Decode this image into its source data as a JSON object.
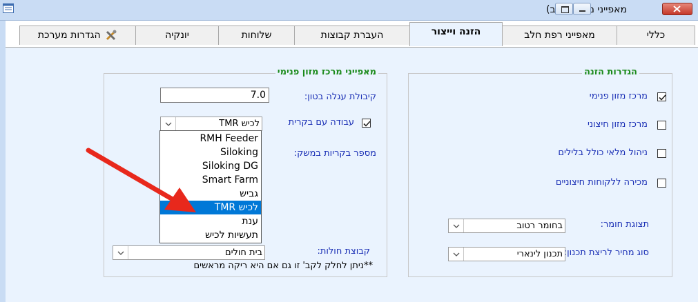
{
  "window": {
    "title": "מאפייני משק (חלב)"
  },
  "tabs": [
    {
      "label": "כללי"
    },
    {
      "label": "מאפייני רפת חלב"
    },
    {
      "label": "הזנה וייצור"
    },
    {
      "label": "העברת קבוצות"
    },
    {
      "label": "שלוחות"
    },
    {
      "label": "יונקיה"
    },
    {
      "label": "הגדרות מערכת"
    }
  ],
  "feeding_settings": {
    "title": "הגדרות הזנה",
    "internal_center": {
      "label": "מרכז מזון פנימי",
      "checked": true
    },
    "external_center": {
      "label": "מרכז מזון חיצוני",
      "checked": false
    },
    "full_stock": {
      "label": "ניהול מלאי כולל בלילים",
      "checked": false
    },
    "sale_external": {
      "label": "מכירה ללקוחות חיצוניים",
      "checked": false
    },
    "material_display": {
      "label": "תצוגת חומר:",
      "value": "בחומר רטוב"
    },
    "price_run": {
      "label": "סוג מחיר לריצת תכנון:",
      "value": "תכנון לינארי"
    }
  },
  "internal_center": {
    "title": "מאפייני מרכז מזון פנימי",
    "calf_capacity": {
      "label": "קיבולת עגלה בטון:",
      "value": "7.0"
    },
    "work_with_controller": {
      "label": "עבודה עם בקרית",
      "checked": true,
      "value": "לכיש TMR"
    },
    "controllers_count": {
      "label": "מספר בקריות במשק:"
    },
    "dropdown_options": [
      "RMH Feeder",
      "Siloking",
      "Siloking DG",
      "Smart Farm",
      "גביש",
      "לכיש TMR",
      "ענת",
      "תעשיות לכיש"
    ],
    "selected_option": "לכיש TMR",
    "sheds_group": {
      "label": "קבוצת חולות:",
      "value": "בית חולים"
    },
    "note": "**ניתן לחלק לקב' זו גם אם היא ריקה מראשים"
  },
  "colors": {
    "accent": "#0078d7",
    "group_title": "#1b8a1b",
    "label": "#1a2fb5",
    "panel": "#eaf3fe",
    "annotation": "#e8281c"
  }
}
